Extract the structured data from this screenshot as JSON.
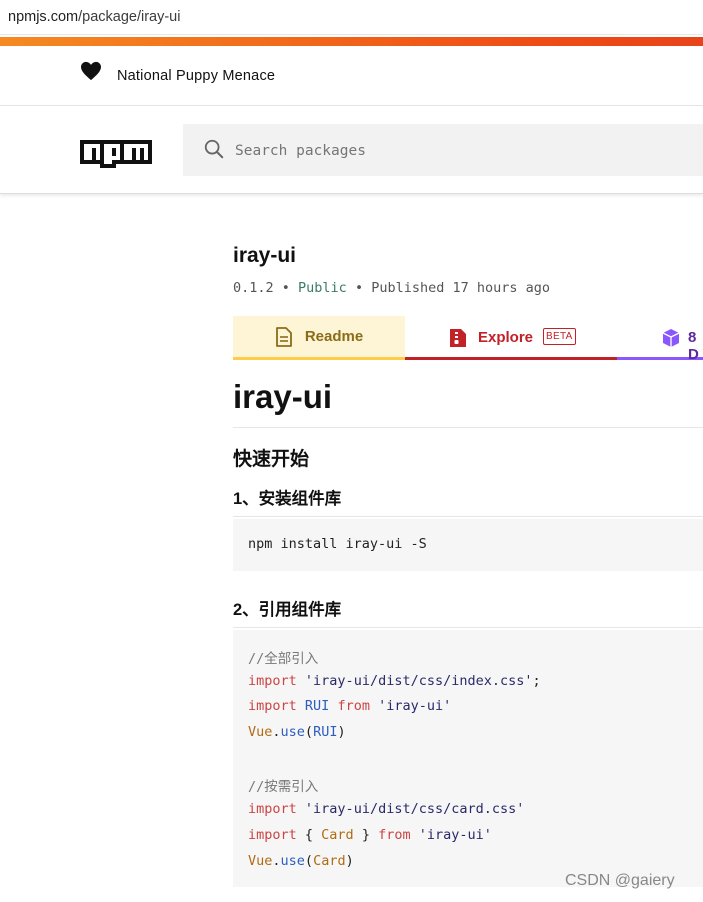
{
  "browser": {
    "url_host": "npmjs.com",
    "url_path": "/package/iray-ui"
  },
  "topnav": {
    "tagline": "National Puppy Menace"
  },
  "search": {
    "placeholder": "Search packages"
  },
  "package": {
    "name": "iray-ui",
    "version": "0.1.2",
    "visibility": "Public",
    "published": "Published 17 hours ago"
  },
  "tabs": {
    "readme": "Readme",
    "explore": "Explore",
    "beta": "BETA",
    "deps": "8 D"
  },
  "readme": {
    "h1": "iray-ui",
    "quick_start": "快速开始",
    "step1": "1、安装组件库",
    "install_cmd": "npm install iray-ui -S",
    "step2": "2、引用组件库",
    "comment_all": "//全部引入",
    "import_css_all": "'iray-ui/dist/css/index.css'",
    "import_kw": "import",
    "from_kw": "from",
    "rui": "RUI",
    "pkg_str": "'iray-ui'",
    "vue": "Vue",
    "use": "use",
    "comment_partial": "//按需引入",
    "import_css_card": "'iray-ui/dist/css/card.css'",
    "card": "Card"
  },
  "watermark": "CSDN @gaiery",
  "colors": {
    "accent_bar": "#f26a1b",
    "readme_tab": "#fef5d6",
    "explore_tab": "#c12127",
    "deps_tab": "#8956ff"
  }
}
